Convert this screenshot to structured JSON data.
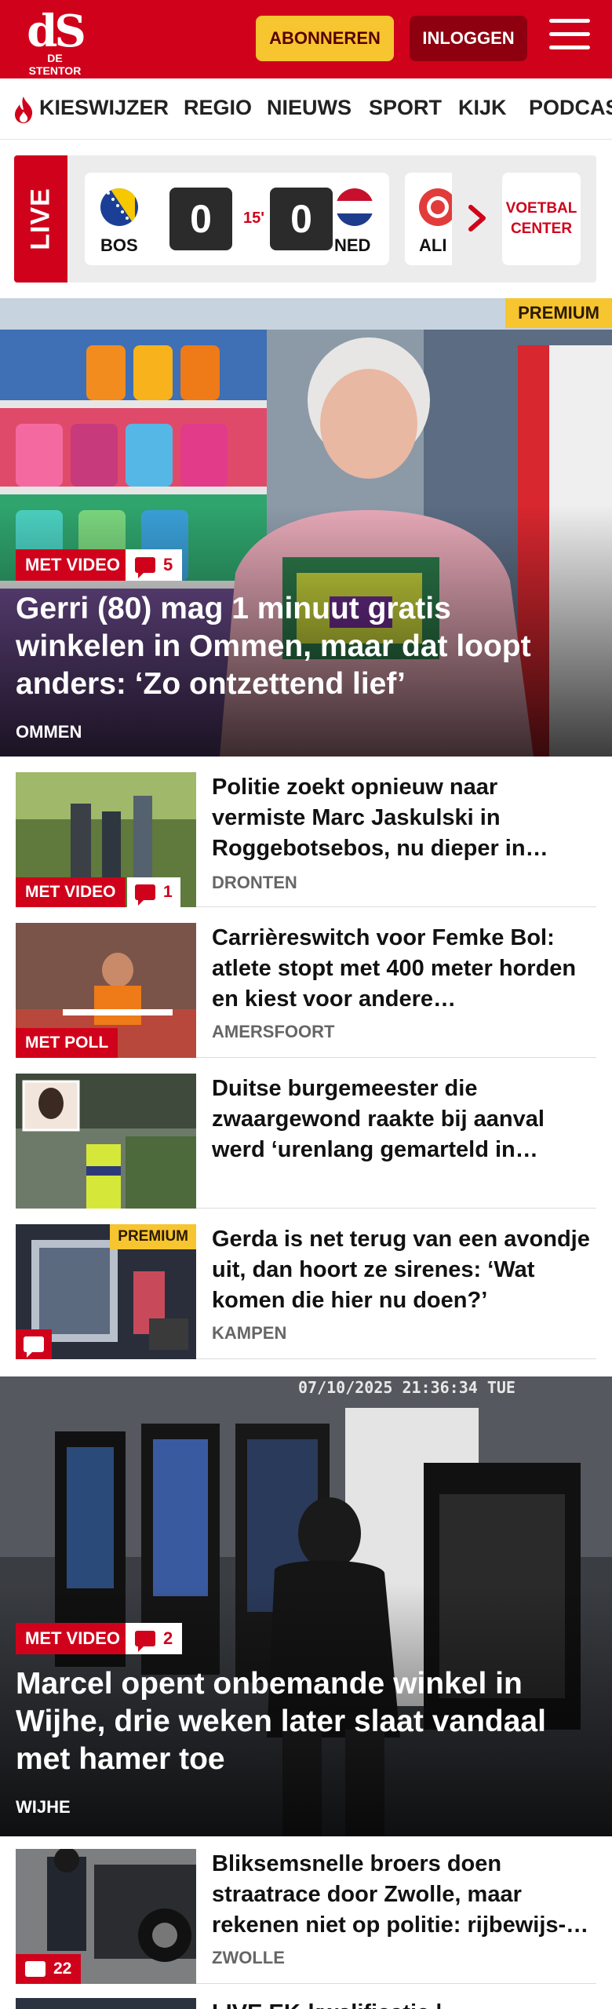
{
  "header": {
    "logo_text": "dS",
    "logo_subtitle": "DE STENTOR",
    "subscribe_label": "ABONNEREN",
    "login_label": "INLOGGEN",
    "menu_icon": "hamburger-icon",
    "brand_color": "#d0021b"
  },
  "nav": {
    "items": [
      {
        "label": "KIESWIJZER",
        "icon": "flame-icon"
      },
      {
        "label": "REGIO"
      },
      {
        "label": "NIEUWS"
      },
      {
        "label": "SPORT"
      },
      {
        "label": "KIJK"
      },
      {
        "label": "PODCAS"
      }
    ]
  },
  "live": {
    "label": "LIVE",
    "match": {
      "home_code": "BOS",
      "away_code": "NED",
      "home_score": "0",
      "away_score": "0",
      "minute": "15'"
    },
    "next_match_code": "ALI",
    "center_label": "VOETBAL CENTER"
  },
  "hero1": {
    "premium": "PREMIUM",
    "video_label": "MET VIDEO",
    "comments": "5",
    "title": "Gerri (80) mag 1 minuut gratis winkelen in Ommen, maar dat loopt anders: ‘Zo ontzettend lief’",
    "location": "OMMEN"
  },
  "articles": [
    {
      "title": "Politie zoekt opnieuw naar vermiste Marc Jaskulski in Roggebotsebos, nu dieper in…",
      "location": "DRONTEN",
      "badge": "MET VIDEO",
      "comments": "1"
    },
    {
      "title": "Carrièreswitch voor Femke Bol: atlete stopt met 400 meter horden en kiest voor andere…",
      "location": "AMERSFOORT",
      "badge": "MET POLL"
    },
    {
      "title": "Duitse burgemeester die zwaargewond raakte bij aanval werd ‘urenlang gemarteld in…",
      "location": ""
    },
    {
      "title": "Gerda is net terug van een avondje uit, dan hoort ze sirenes: ‘Wat komen die hier nu doen?’",
      "location": "KAMPEN",
      "premium": "PREMIUM"
    }
  ],
  "hero2": {
    "video_label": "MET VIDEO",
    "comments": "2",
    "timestamp": "07/10/2025 21:36:34 TUE",
    "title": "Marcel opent onbemande winkel in Wijhe, drie weken later slaat vandaal met hamer toe",
    "location": "WIJHE"
  },
  "article5": {
    "title": "Bliksemsnelle broers doen straatrace door Zwolle, maar rekenen niet op politie: rijbewijs-…",
    "location": "ZWOLLE",
    "comments": "22"
  },
  "article6": {
    "title": "LIVE EK-kwalificatie | …"
  }
}
